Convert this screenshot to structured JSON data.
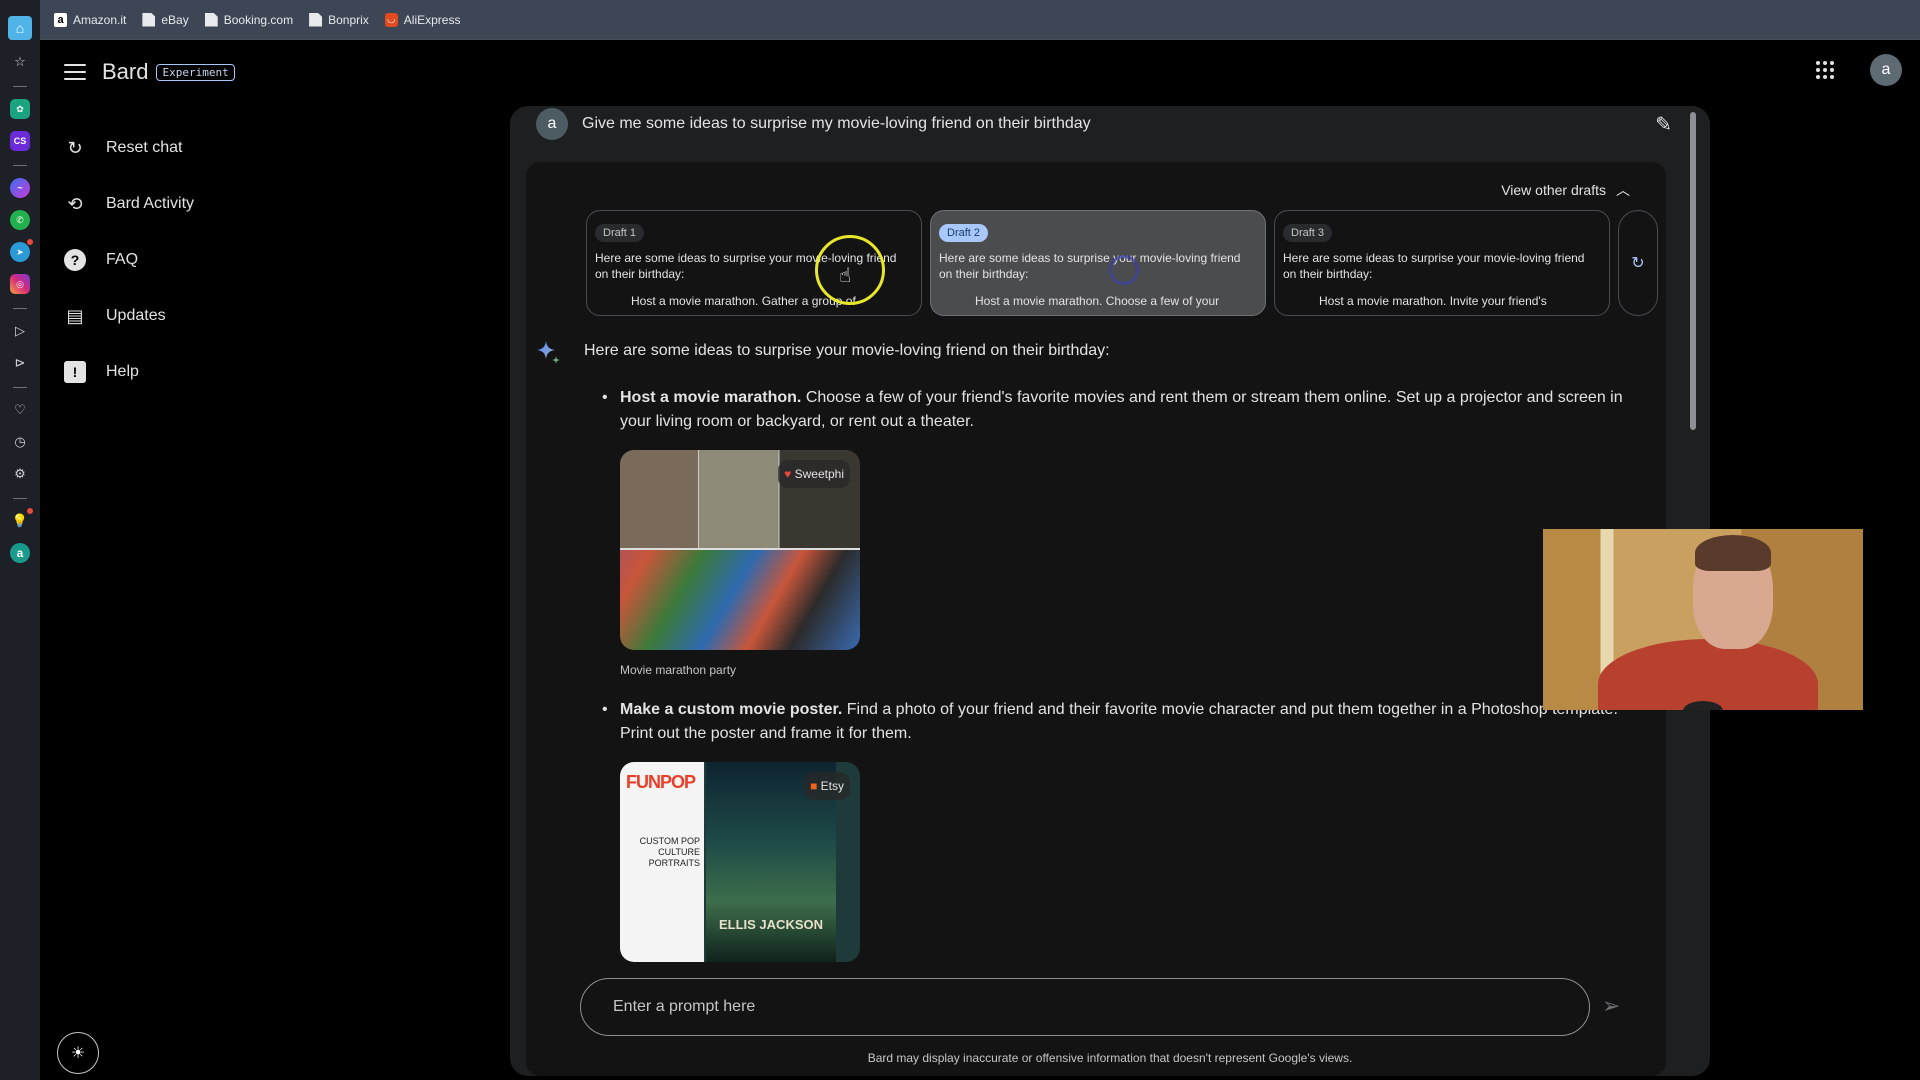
{
  "browser": {
    "bookmarks": [
      {
        "label": "Amazon.it",
        "icon": "amazon-icon"
      },
      {
        "label": "eBay",
        "icon": "page-icon"
      },
      {
        "label": "Booking.com",
        "icon": "page-icon"
      },
      {
        "label": "Bonprix",
        "icon": "page-icon"
      },
      {
        "label": "AliExpress",
        "icon": "aliexpress-icon"
      }
    ]
  },
  "rail": {
    "icons": [
      "home-icon",
      "star-icon",
      "chatgpt-icon",
      "cs-app-icon",
      "messenger-icon",
      "whatsapp-icon",
      "telegram-icon",
      "instagram-icon",
      "play-icon",
      "send-icon",
      "heart-icon",
      "clock-icon",
      "gear-icon",
      "lightbulb-icon",
      "account-icon"
    ]
  },
  "app": {
    "title": "Bard",
    "badge": "Experiment"
  },
  "sidebar": {
    "items": [
      {
        "label": "Reset chat",
        "icon": "reset-icon"
      },
      {
        "label": "Bard Activity",
        "icon": "history-icon"
      },
      {
        "label": "FAQ",
        "icon": "help-circle-icon"
      },
      {
        "label": "Updates",
        "icon": "calendar-icon"
      },
      {
        "label": "Help",
        "icon": "feedback-icon"
      }
    ]
  },
  "header": {
    "avatar_letter": "a"
  },
  "conversation": {
    "user_avatar": "a",
    "prompt": "Give me some ideas to surprise my movie-loving friend on their birthday",
    "drafts_toggle": "View other drafts",
    "drafts": [
      {
        "tag": "Draft 1",
        "text": "Here are some ideas to surprise your movie-loving friend on their birthday:",
        "bullet": "Host a movie marathon. Gather a group of",
        "selected": false
      },
      {
        "tag": "Draft 2",
        "text": "Here are some ideas to surprise your movie-loving friend on their birthday:",
        "bullet": "Host a movie marathon. Choose a few of your",
        "selected": true
      },
      {
        "tag": "Draft 3",
        "text": "Here are some ideas to surprise your movie-loving friend on their birthday:",
        "bullet": "Host a movie marathon. Invite your friend's",
        "selected": false
      }
    ],
    "answer": {
      "lead": "Here are some ideas to surprise your movie-loving friend on their birthday:",
      "items": [
        {
          "title": "Host a movie marathon.",
          "body": " Choose a few of your friend's favorite movies and rent them or stream them online. Set up a projector and screen in your living room or backyard, or rent out a theater.",
          "image": {
            "source": "Sweetphi",
            "caption": "Movie marathon party"
          }
        },
        {
          "title": "Make a custom movie poster.",
          "body": " Find a photo of your friend and their favorite movie character and put them together in a Photoshop template. Print out the poster and frame it for them.",
          "image": {
            "source": "Etsy",
            "brand": "FUNPOP",
            "side_text": "CUSTOM POP CULTURE PORTRAITS",
            "poster_title": "ELLIS JACKSON"
          }
        }
      ]
    }
  },
  "composer": {
    "placeholder": "Enter a prompt here",
    "value": "",
    "disclaimer": "Bard may display inaccurate or offensive information that doesn't represent Google's views."
  },
  "colors": {
    "accent": "#a8c7fa",
    "panel": "#1e1f20",
    "response_bg": "#131314",
    "cursor_highlight": "#e6e62a"
  }
}
